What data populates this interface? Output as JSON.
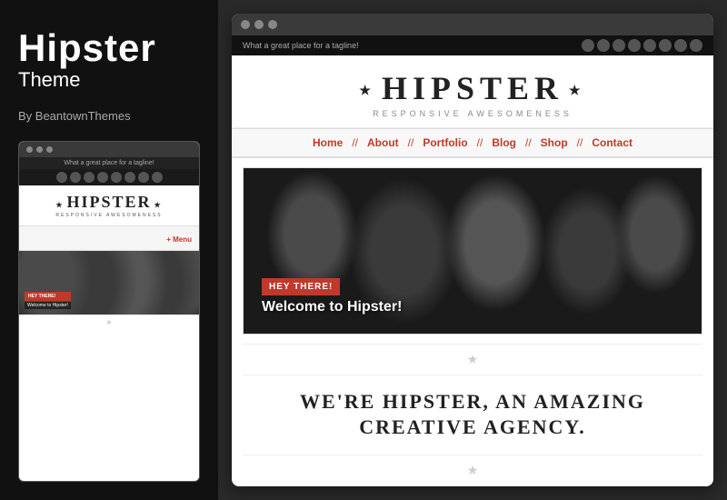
{
  "left": {
    "title": "Hipster",
    "subtitle": "Theme",
    "by": "By BeantownThemes",
    "mini_browser": {
      "tagline": "What a great place for a tagline!",
      "logo_text": "HIPSTER",
      "logo_sub": "RESPONSIVE AWESOMENESS",
      "menu_label": "+ Menu",
      "hero_badge": "HEY THERE!",
      "hero_welcome": "Welcome to Hipster!"
    }
  },
  "right": {
    "browser": {
      "tagline": "What a great place for a tagline!",
      "logo_text": "HIPSTER",
      "logo_sub": "RESPONSIVE AWESOMENESS",
      "nav_items": [
        "Home",
        "About",
        "Portfolio",
        "Blog",
        "Shop",
        "Contact"
      ],
      "hero_badge": "HEY THERE!",
      "hero_welcome": "Welcome to Hipster!",
      "star_divider": "★",
      "copy_line1": "WE'RE HIPSTER, AN AMAZING",
      "copy_line2": "CREATIVE AGENCY."
    }
  },
  "dots": [
    "●",
    "●",
    "●"
  ]
}
